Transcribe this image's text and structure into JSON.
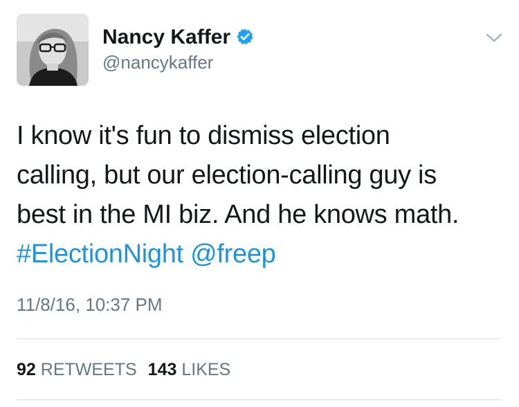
{
  "author": {
    "display_name": "Nancy Kaffer",
    "handle": "@nancykaffer",
    "verified": true,
    "avatar": "profile-photo"
  },
  "tweet": {
    "lines": [
      "I know it's fun to dismiss election",
      "calling, but our election-calling guy is",
      "best in the MI biz. And he knows math."
    ],
    "hashtag": "#ElectionNight",
    "mention": "@freep",
    "timestamp": "11/8/16, 10:37 PM"
  },
  "stats": {
    "retweets_count": "92",
    "retweets_label": "RETWEETS",
    "likes_count": "143",
    "likes_label": "LIKES"
  },
  "colors": {
    "link": "#1b95e0",
    "muted": "#657786",
    "text": "#14171a",
    "divider": "#d6dde3"
  }
}
